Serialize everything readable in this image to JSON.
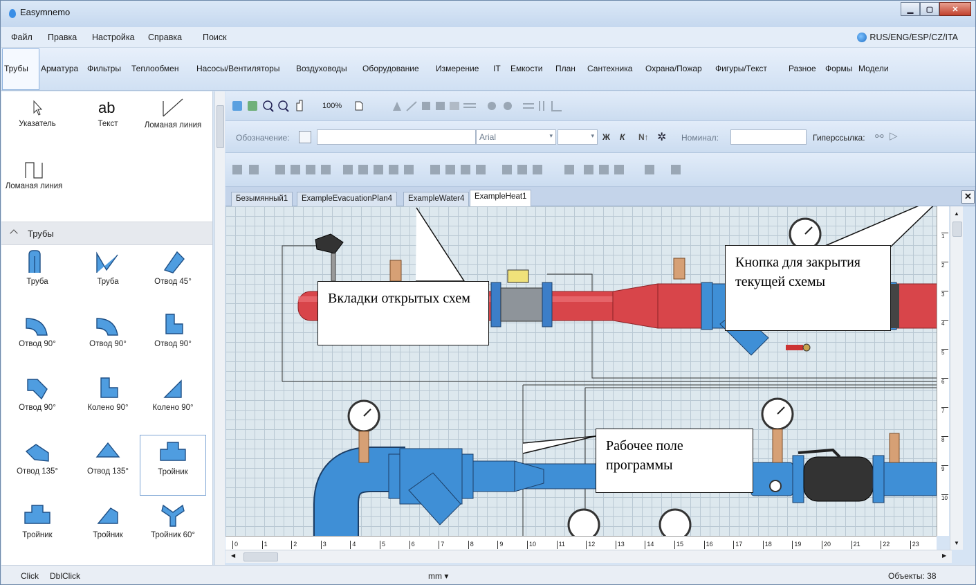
{
  "window": {
    "title": "Easymnemo"
  },
  "menu": [
    "Файл",
    "Правка",
    "Настройка",
    "Справка",
    "Поиск"
  ],
  "language_switch": "RUS/ENG/ESP/CZ/ITA",
  "categories": [
    "Трубы",
    "Арматура",
    "Фильтры",
    "Теплообмен",
    "Насосы/Вентиляторы",
    "Воздуховоды",
    "Оборудование",
    "Измерение",
    "IT",
    "Емкости",
    "План",
    "Сантехника",
    "Охрана/Пожар",
    "Фигуры/Текст",
    "Разное",
    "Формы",
    "Модели"
  ],
  "basic_tools": [
    {
      "label": "Указатель",
      "icon": "pointer-icon"
    },
    {
      "label": "Текст",
      "icon": "text-icon"
    },
    {
      "label": "Ломаная линия",
      "icon": "polyline-icon"
    },
    {
      "label": "Ломаная линия",
      "icon": "polyline-rect-icon"
    }
  ],
  "section": {
    "title": "Трубы"
  },
  "pipe_items": [
    {
      "label": "Труба"
    },
    {
      "label": "Труба"
    },
    {
      "label": "Отвод 45°"
    },
    {
      "label": "Отвод 90°"
    },
    {
      "label": "Отвод 90°"
    },
    {
      "label": "Отвод 90°"
    },
    {
      "label": "Отвод 90°"
    },
    {
      "label": "Колено 90°"
    },
    {
      "label": "Колено 90°"
    },
    {
      "label": "Отвод 135°"
    },
    {
      "label": "Отвод 135°"
    },
    {
      "label": "Тройник"
    },
    {
      "label": "Тройник"
    },
    {
      "label": "Тройник"
    },
    {
      "label": "Тройник 60°"
    }
  ],
  "toolbar": {
    "zoom": "100%",
    "designation_label": "Обозначение:",
    "font": "Arial",
    "bold": "Ж",
    "italic": "К",
    "nominal_label": "Номинал:",
    "hyperlink_label": "Гиперссылка:"
  },
  "tabs": [
    "Безымянный1",
    "ExampleEvacuationPlan4",
    "ExampleWater4",
    "ExampleHeat1"
  ],
  "active_tab": "ExampleHeat1",
  "callouts": {
    "tabs": "Вкладки открытых схем",
    "close": "Кнопка для закрытия текущей схемы",
    "workspace": "Рабочее поле программы"
  },
  "ruler_h": [
    "0",
    "1",
    "2",
    "3",
    "4",
    "5",
    "6",
    "7",
    "8",
    "9",
    "10",
    "11",
    "12",
    "13",
    "14",
    "15",
    "16",
    "17",
    "18",
    "19",
    "20",
    "21",
    "22",
    "23"
  ],
  "ruler_v": [
    "1",
    "2",
    "3",
    "4",
    "5",
    "6",
    "7",
    "8",
    "9",
    "10"
  ],
  "status": {
    "click": "Click",
    "dblclick": "DblClick",
    "units": "mm",
    "objects": "Объекты: 38"
  },
  "colors": {
    "hot_pipe": "#d8454a",
    "cold_pipe": "#3f8fd6",
    "accent": "#2f7fd8"
  }
}
